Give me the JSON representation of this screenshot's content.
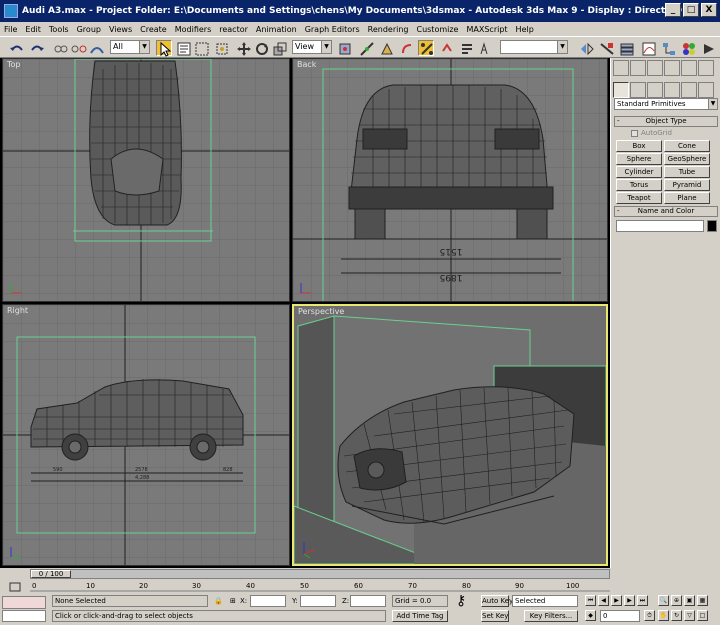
{
  "window": {
    "title": "Audi A3.max    - Project Folder: E:\\Documents and Settings\\chens\\My Documents\\3dsmax    - Autodesk 3ds Max 9    - Display : Direct 3D",
    "minimize": "_",
    "maximize": "□",
    "close": "X"
  },
  "menu": [
    "File",
    "Edit",
    "Tools",
    "Group",
    "Views",
    "Create",
    "Modifiers",
    "reactor",
    "Animation",
    "Graph Editors",
    "Rendering",
    "Customize",
    "MAXScript",
    "Help"
  ],
  "toolbar": {
    "selection_filter": "All",
    "ref_coord": "View",
    "named_selection": ""
  },
  "viewports": {
    "top": "Top",
    "back": "Back",
    "right": "Right",
    "perspective": "Perspective",
    "back_dims": [
      "1515",
      "1895"
    ],
    "right_dims": [
      "590",
      "2578",
      "828",
      "4,288"
    ]
  },
  "command_panel": {
    "dropdown": "Standard Primitives",
    "object_type": "Object Type",
    "autogrid": "AutoGrid",
    "buttons": [
      "Box",
      "Cone",
      "Sphere",
      "GeoSphere",
      "Cylinder",
      "Tube",
      "Torus",
      "Pyramid",
      "Teapot",
      "Plane"
    ],
    "name_and_color": "Name and Color"
  },
  "timeline": {
    "slider": "0 / 100",
    "ticks": [
      "0",
      "10",
      "20",
      "30",
      "40",
      "50",
      "60",
      "70",
      "80",
      "90",
      "100"
    ]
  },
  "status": {
    "selection": "None Selected",
    "x_label": "X:",
    "y_label": "Y:",
    "z_label": "Z:",
    "grid": "Grid = 0.0",
    "auto_key": "Auto Key",
    "set_key": "Set Key",
    "key_mode": "Selected",
    "key_filters": "Key Filters...",
    "frame": "0",
    "prompt": "Click or click-and-drag to select objects",
    "add_time_tag": "Add Time Tag"
  },
  "colors": {
    "title_bar": "#0a246a",
    "viewport_bg": "#7a7a7a",
    "active_viewport_border": "#e8e870",
    "ui_gray": "#d4d0c8"
  }
}
